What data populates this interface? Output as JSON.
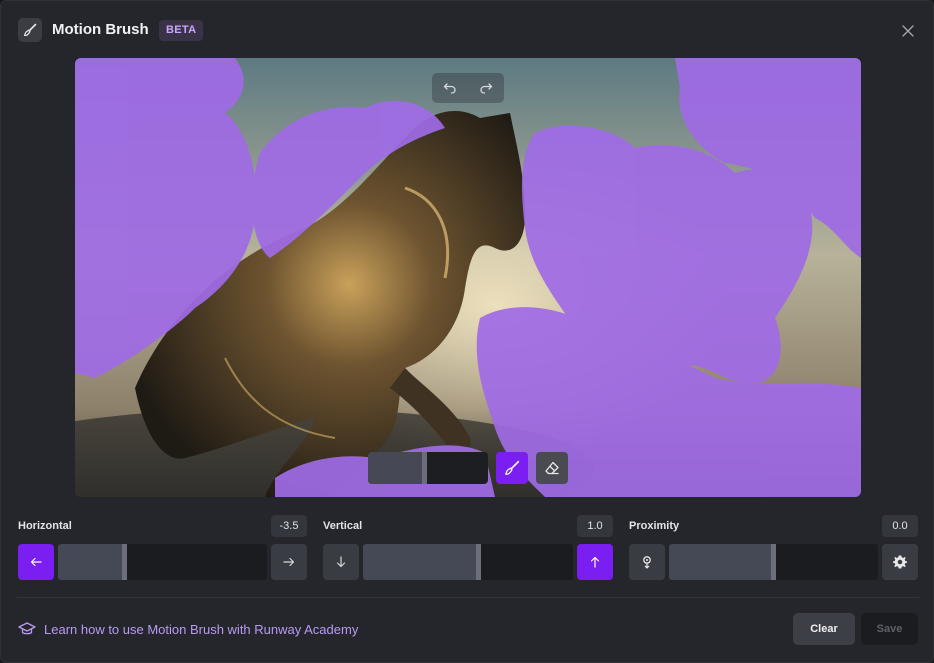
{
  "header": {
    "title": "Motion Brush",
    "badge": "BETA"
  },
  "canvas": {
    "brush_size": 0.45
  },
  "controls": {
    "horizontal": {
      "label": "Horizontal",
      "value": "-3.5",
      "level": 0.32
    },
    "vertical": {
      "label": "Vertical",
      "value": "1.0",
      "level": 0.55
    },
    "proximity": {
      "label": "Proximity",
      "value": "0.0",
      "level": 0.5
    }
  },
  "footer": {
    "academy_link": "Learn how to use Motion Brush with Runway Academy",
    "clear_label": "Clear",
    "save_label": "Save"
  },
  "colors": {
    "accent": "#7a1ef2",
    "brush_mask": "#a06be6",
    "link": "#b99af2"
  },
  "icons": {
    "header": "paintbrush-icon",
    "close": "close-icon",
    "undo": "undo-icon",
    "redo": "redo-icon",
    "brush": "paintbrush-icon",
    "eraser": "eraser-icon",
    "left": "arrow-left-icon",
    "right": "arrow-right-icon",
    "down": "arrow-down-icon",
    "up": "arrow-up-icon",
    "proximity": "proximity-icon",
    "settings": "gear-icon",
    "academy": "graduation-cap-icon"
  }
}
